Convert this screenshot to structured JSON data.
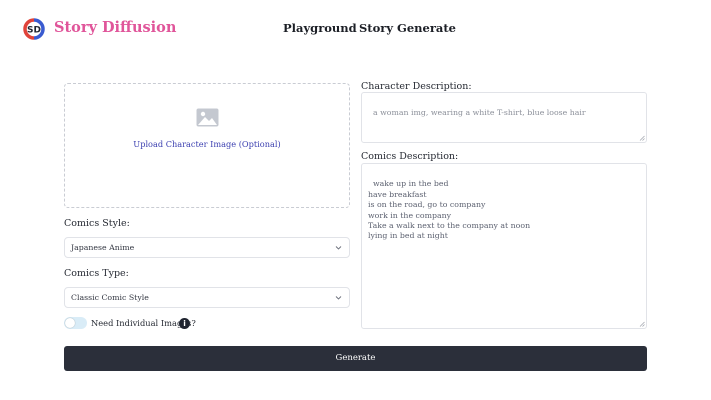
{
  "header": {
    "brand": "Story Diffusion",
    "nav": {
      "playground": "Playground",
      "story_generate": "Story Generate"
    }
  },
  "upload": {
    "label": "Upload Character Image (Optional)"
  },
  "comics_style": {
    "label": "Comics Style:",
    "value": "Japanese Anime"
  },
  "comics_type": {
    "label": "Comics Type:",
    "value": "Classic Comic Style"
  },
  "individual_images": {
    "label": "Need Individual Images?",
    "enabled": false,
    "info_icon": "i"
  },
  "character_description": {
    "label": "Character Description:",
    "placeholder": "a woman img, wearing a white T-shirt, blue loose hair"
  },
  "comics_description": {
    "label": "Comics Description:",
    "value": "wake up in the bed\nhave breakfast\nis on the road, go to company\nwork in the company\nTake a walk next to the company at noon\nlying in bed at night"
  },
  "generate_button": {
    "label": "Generate"
  },
  "colors": {
    "brand": "#e0559a",
    "button": "#2b2f3a",
    "link": "#3b3fb0",
    "toggle": "#d9ecf7"
  },
  "icons": [
    "story-diffusion-logo-icon",
    "image-placeholder-icon",
    "chevron-down-icon",
    "info-icon",
    "resize-handle-icon"
  ]
}
